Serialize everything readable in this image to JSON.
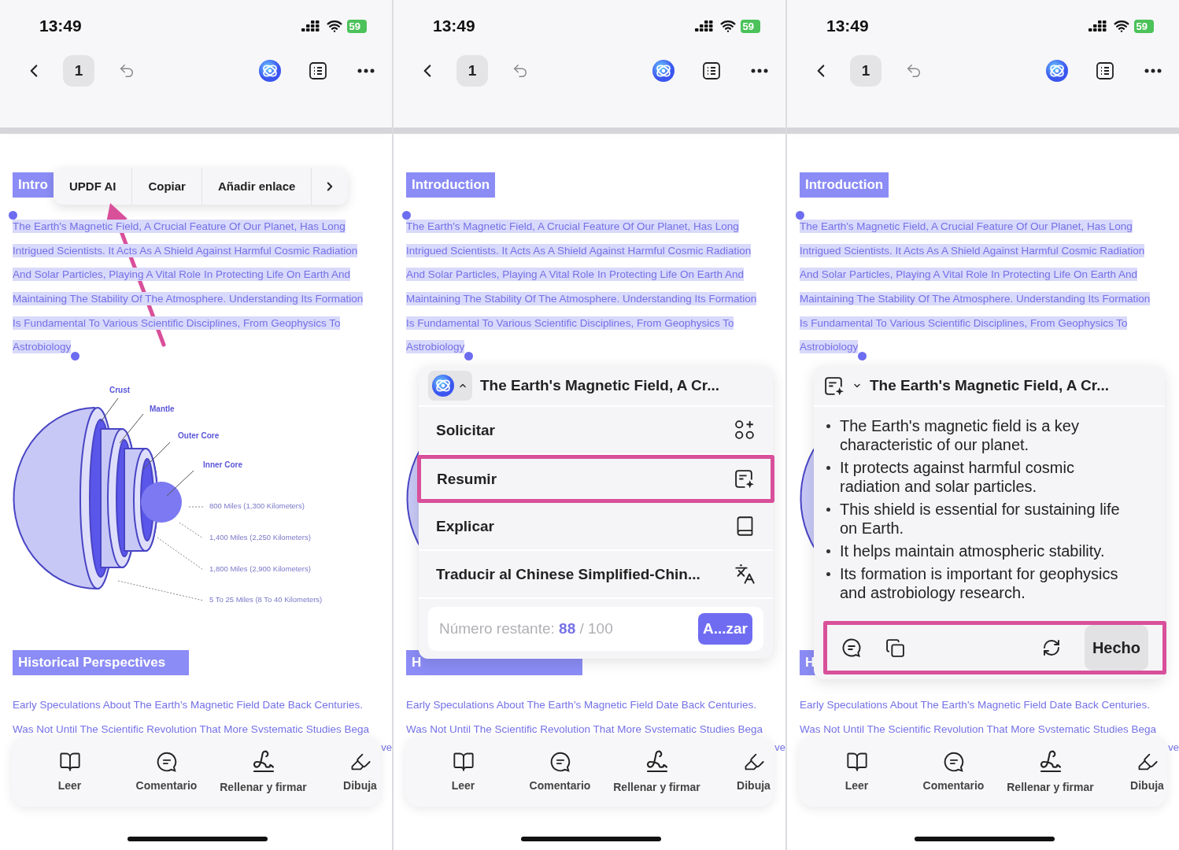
{
  "phones": [
    {
      "status_bar": {
        "time": "13:49",
        "battery": "59"
      },
      "toolbar": {
        "page": "1"
      },
      "document": {
        "heading": "Intro",
        "text_selected": true,
        "paragraph": [
          "The Earth's Magnetic Field, A Crucial Feature Of Our Planet, Has Long",
          "Intrigued Scientists. It Acts As A Shield Against Harmful Cosmic Radiation",
          "And Solar Particles, Playing A Vital Role In Protecting Life On Earth And",
          "Maintaining The Stability Of The Atmosphere. Understanding Its Formation",
          "Is Fundamental To Various Scientific Disciplines, From Geophysics To",
          "Astrobiology"
        ],
        "diagram_labels": [
          "Crust",
          "Mantle",
          "Outer Core",
          "Inner Core",
          "800 Miles (1,300 Kilometers)",
          "1,400 Miles (2,250 Kilometers)",
          "1,800 Miles (2,900 Kilometers)",
          "5 To 25 Miles (8 To 40 Kilometers)"
        ],
        "heading_2": "Historical Perspectives",
        "paragraph_2": [
          "Early Speculations About The Earth's Magnetic Field Date Back Centuries.",
          "Was Not Until The Scientific Revolution That More Svstematic Studies Bega"
        ],
        "fragment": "ve"
      },
      "overlay": {
        "kind": "context_menu",
        "items": [
          "UPDF AI",
          "Copiar",
          "Añadir enlace"
        ],
        "more": true
      },
      "annotation_arrow": true,
      "bottom_toolbar": [
        "Leer",
        "Comentario",
        "Rellenar y firmar",
        "Dibuja"
      ]
    },
    {
      "status_bar": {
        "time": "13:49",
        "battery": "59"
      },
      "toolbar": {
        "page": "1"
      },
      "document": {
        "heading": "Introduction",
        "text_selected": true,
        "paragraph": [
          "The Earth's Magnetic Field, A Crucial Feature Of Our Planet, Has Long",
          "Intrigued Scientists. It Acts As A Shield Against Harmful Cosmic Radiation",
          "And Solar Particles, Playing A Vital Role In Protecting Life On Earth And",
          "Maintaining The Stability Of The Atmosphere. Understanding Its Formation",
          "Is Fundamental To Various Scientific Disciplines, From Geophysics To",
          "Astrobiology"
        ],
        "heading_2": "H",
        "paragraph_2": [
          "Early Speculations About The Earth's Magnetic Field Date Back Centuries.",
          "Was Not Until The Scientific Revolution That More Svstematic Studies Bega"
        ],
        "fragment": "ve"
      },
      "overlay": {
        "kind": "ai_menu",
        "title": "The Earth's Magnetic Field, A Cr...",
        "menu_expanded": true,
        "items": [
          {
            "label": "Solicitar",
            "highlighted": false
          },
          {
            "label": "Resumir",
            "highlighted": true
          },
          {
            "label": "Explicar",
            "highlighted": false
          },
          {
            "label": "Traducir al Chinese Simplified-Chin...",
            "highlighted": false
          }
        ],
        "remaining_label": "Número restante:",
        "remaining_count": "88",
        "remaining_total": "/ 100",
        "button": "A...zar"
      },
      "bottom_toolbar": [
        "Leer",
        "Comentario",
        "Rellenar y firmar",
        "Dibuja"
      ]
    },
    {
      "status_bar": {
        "time": "13:49",
        "battery": "59"
      },
      "toolbar": {
        "page": "1"
      },
      "document": {
        "heading": "Introduction",
        "text_selected": true,
        "paragraph": [
          "The Earth's Magnetic Field, A Crucial Feature Of Our Planet, Has Long",
          "Intrigued Scientists. It Acts As A Shield Against Harmful Cosmic Radiation",
          "And Solar Particles, Playing A Vital Role In Protecting Life On Earth And",
          "Maintaining The Stability Of The Atmosphere. Understanding Its Formation",
          "Is Fundamental To Various Scientific Disciplines, From Geophysics To",
          "Astrobiology"
        ],
        "heading_2": "H",
        "paragraph_2": [
          "Early Speculations About The Earth's Magnetic Field Date Back Centuries.",
          "Was Not Until The Scientific Revolution That More Svstematic Studies Bega"
        ],
        "fragment": "ve"
      },
      "overlay": {
        "kind": "summary",
        "title": "The Earth's Magnetic Field, A Cr...",
        "menu_expanded": false,
        "bullets": [
          "The Earth's magnetic field is a key characteristic of our planet.",
          "It protects against harmful cosmic radiation and solar particles.",
          "This shield is essential for sustaining life on Earth.",
          "It helps maintain atmospheric stability.",
          "Its formation is important for geophysics and astrobiology research."
        ],
        "actions_highlighted": true,
        "button": "Hecho"
      },
      "bottom_toolbar": [
        "Leer",
        "Comentario",
        "Rellenar y firmar",
        "Dibuja"
      ]
    }
  ]
}
